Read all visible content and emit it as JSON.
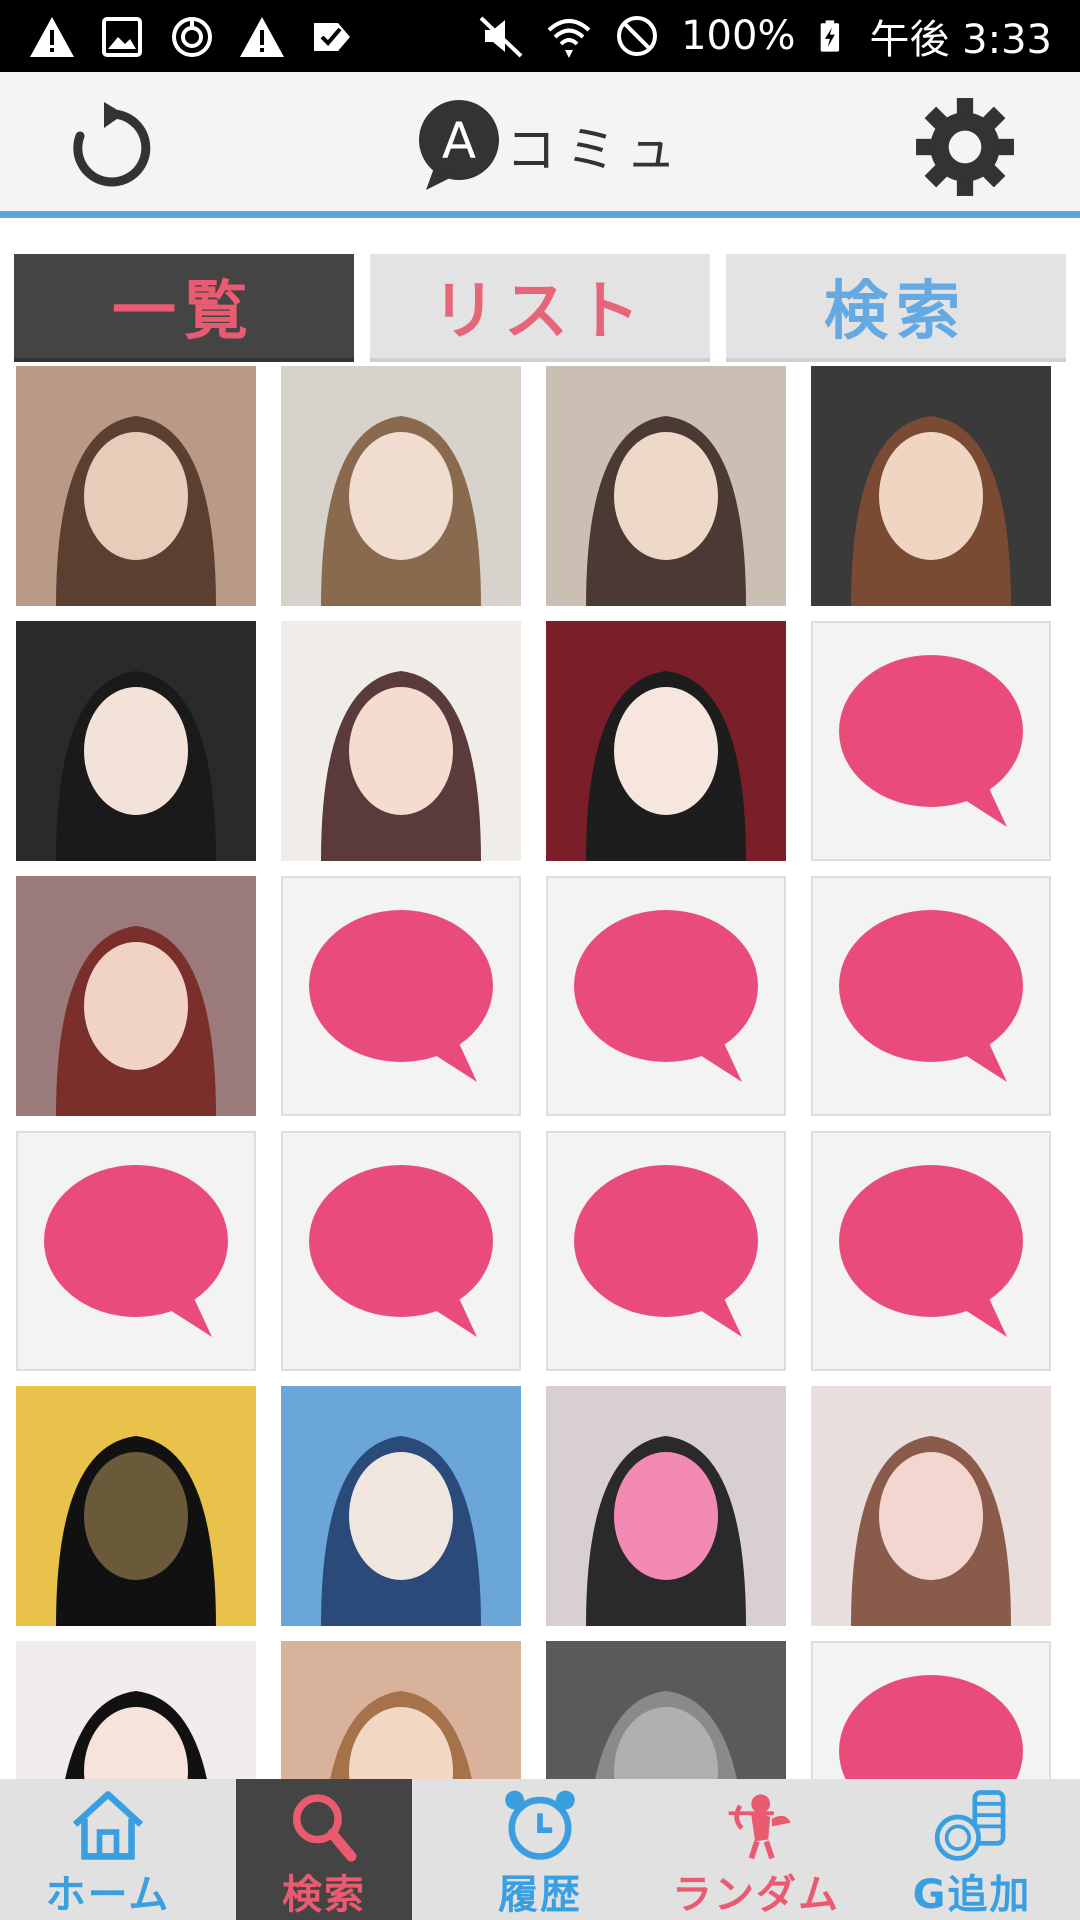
{
  "status_bar": {
    "battery": "100%",
    "time": "午後 3:33",
    "left_icons": [
      "warning-icon",
      "image-icon",
      "sync-icon",
      "warning-icon",
      "checklist-icon"
    ],
    "right_icons": [
      "mute-icon",
      "wifi-icon",
      "do-not-disturb-icon",
      "battery-charging-icon"
    ]
  },
  "header": {
    "logo_letter": "A",
    "logo_text": "コミュ",
    "refresh_icon": "refresh-icon",
    "settings_icon": "gear-icon"
  },
  "tabs": [
    {
      "label": "一覧",
      "active": true
    },
    {
      "label": "リスト",
      "active": false
    },
    {
      "label": "検索",
      "active": false
    }
  ],
  "grid": {
    "cells": [
      "photo",
      "photo",
      "photo",
      "photo",
      "photo",
      "photo",
      "photo",
      "default",
      "photo",
      "default",
      "default",
      "default",
      "default",
      "default",
      "default",
      "default",
      "photo",
      "photo",
      "photo",
      "photo",
      "photo",
      "photo",
      "photo",
      "default"
    ]
  },
  "bottom_nav": [
    {
      "label": "ホーム",
      "icon": "home-icon",
      "active": false,
      "color": "#3a9fe0"
    },
    {
      "label": "検索",
      "icon": "search-icon",
      "active": true,
      "color": "#ea5b71"
    },
    {
      "label": "履歴",
      "icon": "alarm-clock-icon",
      "active": false,
      "color": "#3a9fe0"
    },
    {
      "label": "ランダム",
      "icon": "cupid-icon",
      "active": false,
      "color": "#ea5b71"
    },
    {
      "label": "G追加",
      "icon": "coins-icon",
      "active": false,
      "color": "#3a9fe0"
    }
  ],
  "colors": {
    "accent_blue": "#5aa7e0",
    "accent_pink": "#e94c7a",
    "tab_active_bg": "#444444"
  }
}
